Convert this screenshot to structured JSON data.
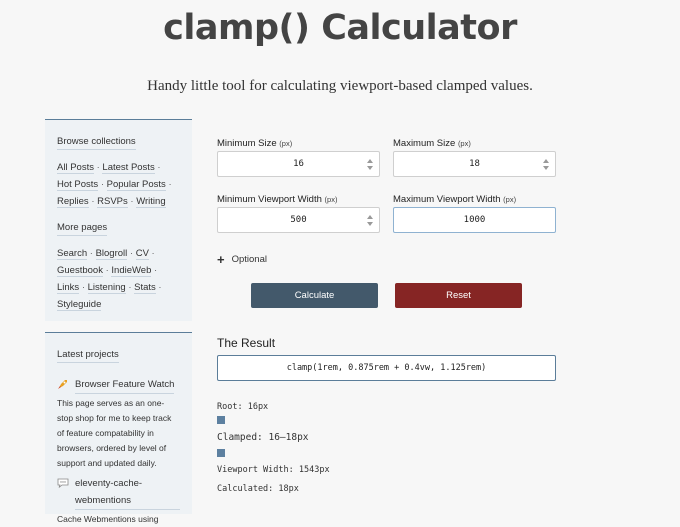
{
  "header": {
    "title": "clamp() Calculator",
    "tagline": "Handy little tool for calculating viewport-based clamped values."
  },
  "sidebar": {
    "collections_heading": "Browse collections",
    "collections": [
      "All Posts",
      "Latest Posts",
      "Hot Posts",
      "Popular Posts",
      "Replies",
      "RSVPs",
      "Writing"
    ],
    "more_heading": "More pages",
    "more": [
      "Search",
      "Blogroll",
      "CV",
      "Guestbook",
      "IndieWeb",
      "Links",
      "Listening",
      "Stats",
      "Styleguide"
    ],
    "projects_heading": "Latest projects",
    "projects": [
      {
        "title": "Browser Feature Watch",
        "description": "This page serves as an one-stop shop for me to keep track of feature compatability in browsers, ordered by level of support and updated daily.",
        "icon": "rocket-icon"
      },
      {
        "title": "eleventy-cache-webmentions",
        "description": "Cache Webmentions using",
        "icon": "speech-bubble-icon"
      }
    ],
    "separator": "·"
  },
  "form": {
    "min_size": {
      "label": "Minimum Size",
      "unit": "(px)",
      "value": "16"
    },
    "max_size": {
      "label": "Maximum Size",
      "unit": "(px)",
      "value": "18"
    },
    "min_vw": {
      "label": "Minimum Viewport Width",
      "unit": "(px)",
      "value": "500"
    },
    "max_vw": {
      "label": "Maximum Viewport Width",
      "unit": "(px)",
      "value": "1000"
    },
    "optional_label": "Optional",
    "calculate_label": "Calculate",
    "reset_label": "Reset"
  },
  "result": {
    "heading": "The Result",
    "value": "clamp(1rem, 0.875rem + 0.4vw, 1.125rem)",
    "root": "Root: 16px",
    "clamped": "Clamped: 16–18px",
    "viewport": "Viewport Width: 1543px",
    "calculated": "Calculated: 18px"
  },
  "colors": {
    "accent": "#5b7d99",
    "calculate_button": "#43596b",
    "reset_button": "#862524",
    "sidebar_bg": "#eef2f5"
  }
}
